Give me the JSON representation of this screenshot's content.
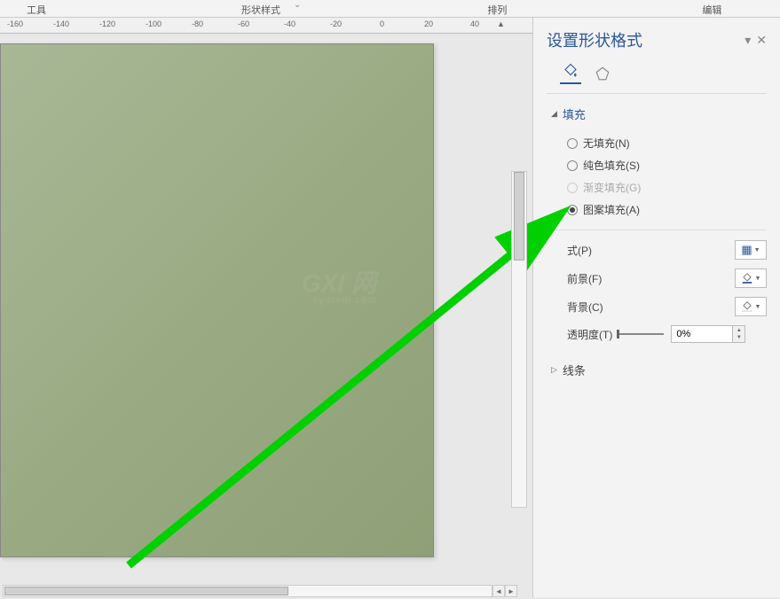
{
  "top_tabs": {
    "tools": "工具",
    "style": "形状样式",
    "arrange": "排列",
    "edit": "编辑"
  },
  "ruler": {
    "ticks": [
      "-160",
      "-140",
      "-120",
      "-100",
      "-80",
      "-60",
      "-40",
      "-20",
      "0",
      "20",
      "40"
    ]
  },
  "watermark": {
    "main": "GXI 网",
    "sub": "system.com"
  },
  "sidebar": {
    "title": "设置形状格式",
    "fill": {
      "title": "填充",
      "no_fill": "无填充(N)",
      "solid_fill": "纯色填充(S)",
      "gradient_fill": "渐变填充(G)",
      "pattern_fill": "图案填充(A)"
    },
    "controls": {
      "pattern": "式(P)",
      "foreground": "前景(F)",
      "background": "背景(C)",
      "transparency": "透明度(T)",
      "transparency_value": "0%"
    },
    "line": {
      "title": "线条"
    }
  }
}
